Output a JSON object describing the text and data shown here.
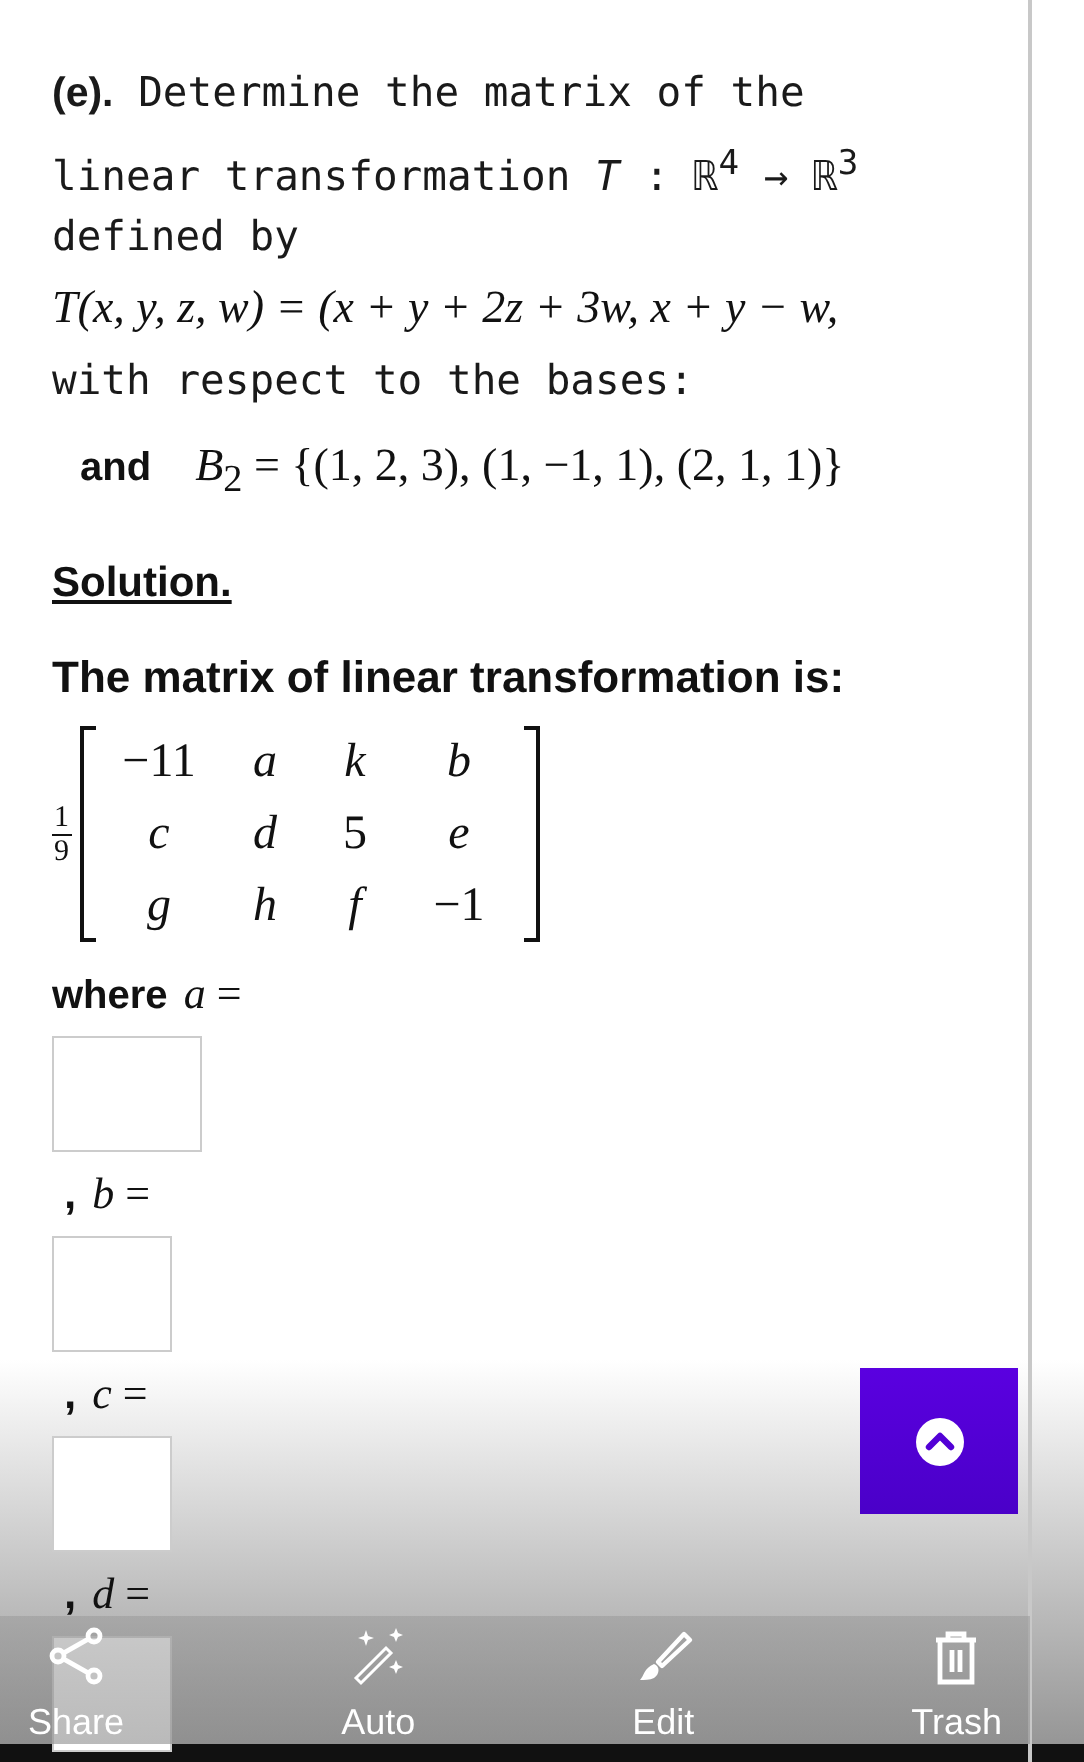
{
  "question": {
    "label": "(e).",
    "lines": [
      "Determine the matrix of the",
      "linear transformation *T* : ℝ$^{4}$ → ℝ$^{3}$",
      "defined by"
    ],
    "formula": "T(x, y, z, w) = (x + y + 2z + 3w, x + y − w,",
    "bases_line": "with respect to the bases:",
    "basis_prefix": "and",
    "basis": "*B*$_{2}$ = {(1, 2, 3), (1, −1, 1), (2, 1, 1)}"
  },
  "solution_heading": "Solution.",
  "answer_intro": "The matrix of linear transformation is:",
  "matrix": {
    "numerator": "1",
    "denominator": "9",
    "rows": [
      [
        "−11",
        "*a*",
        "*k*",
        "*b*"
      ],
      [
        "*c*",
        "*d*",
        "5",
        "*e*"
      ],
      [
        "*g*",
        "*h*",
        "*f*",
        "−1"
      ]
    ]
  },
  "blanks": [
    {
      "prefix": "where",
      "label": "*a* ="
    },
    {
      "prefix": ",",
      "label": "*b* ="
    },
    {
      "prefix": ",",
      "label": "*c* ="
    },
    {
      "prefix": ",",
      "label": "*d* ="
    }
  ],
  "toolbar": [
    {
      "kind": "share",
      "label": "Share"
    },
    {
      "kind": "auto",
      "label": "Auto"
    },
    {
      "kind": "edit",
      "label": "Edit"
    },
    {
      "kind": "trash",
      "label": "Trash"
    }
  ]
}
